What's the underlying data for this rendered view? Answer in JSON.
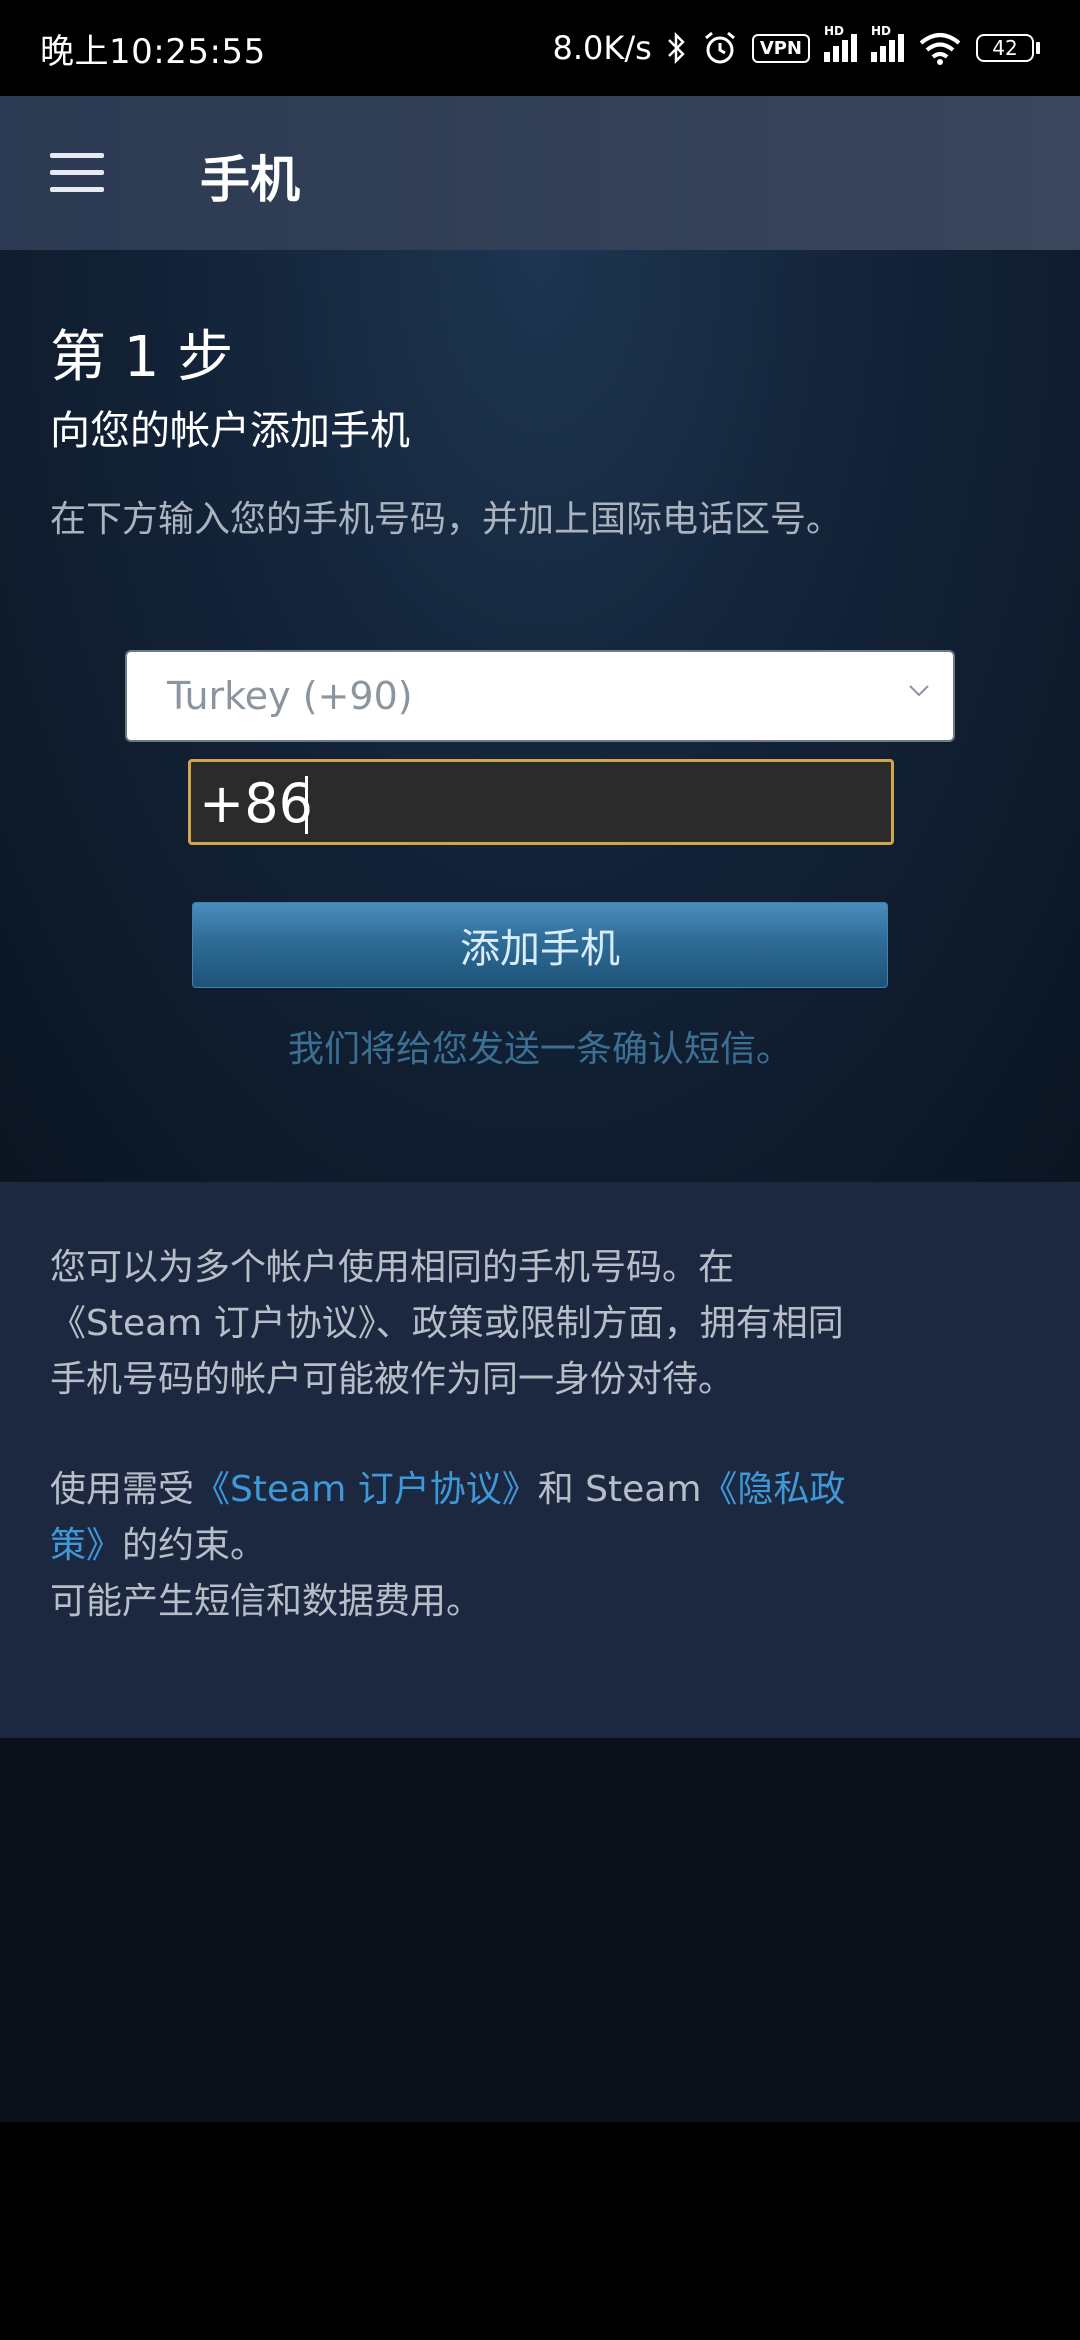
{
  "status_bar": {
    "time": "晚上10:25:55",
    "net_speed": "8.0K/s",
    "vpn": "VPN",
    "hd1": "HD",
    "hd2": "HD",
    "battery": "42",
    "icons": [
      "bluetooth-icon",
      "alarm-icon",
      "vpn-icon",
      "signal-icon",
      "signal-icon",
      "wifi-icon",
      "battery-icon"
    ]
  },
  "app_bar": {
    "title": "手机",
    "menu_icon": "hamburger-menu-icon"
  },
  "step": {
    "title": "第 1 步",
    "subtitle": "向您的帐户添加手机",
    "description": "在下方输入您的手机号码，并加上国际电话区号。"
  },
  "form": {
    "country_value": "Turkey (+90)",
    "phone_value": "+86",
    "add_button": "添加手机",
    "sms_note": "我们将给您发送一条确认短信。"
  },
  "info": {
    "line1": "您可以为多个帐户使用相同的手机号码。在",
    "line2": "《Steam 订户协议》、政策或限制方面，拥有相同",
    "line3": "手机号码的帐户可能被作为同一身份对待。",
    "terms_prefix": "使用需受",
    "ssa_link": "《Steam 订户协议》",
    "terms_and": "和 Steam",
    "privacy_link_part1": "《隐私政",
    "privacy_link_part2": "策》",
    "terms_suffix": "的约束。",
    "fees": "可能产生短信和数据费用。"
  },
  "colors": {
    "link": "#3f98d8",
    "input_border": "#d1a54a",
    "button": "#2e6c97",
    "appbar": "#2b3a52"
  }
}
